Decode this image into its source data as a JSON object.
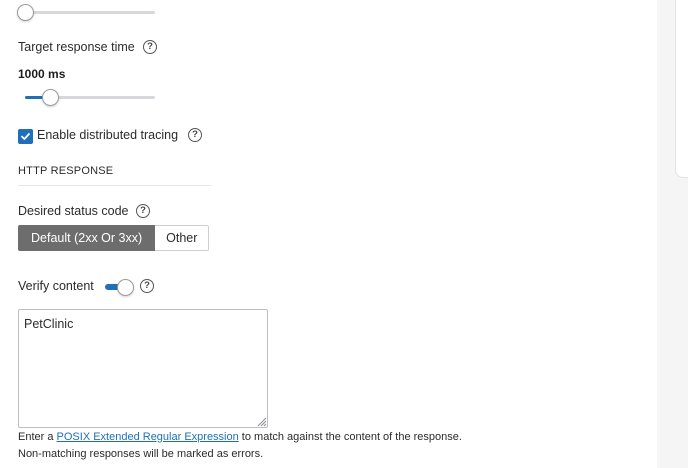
{
  "sliders": {
    "top": {
      "level": 0.0
    },
    "target_response": {
      "label": "Target response time",
      "value_text": "1000 ms",
      "level": 0.19
    }
  },
  "tracing": {
    "label": "Enable distributed tracing",
    "checked": true
  },
  "http_response": {
    "section_title": "HTTP RESPONSE",
    "status_code": {
      "label": "Desired status code",
      "options": [
        "Default (2xx Or 3xx)",
        "Other"
      ],
      "selected": "Default (2xx Or 3xx)"
    },
    "verify_content": {
      "label": "Verify content",
      "enabled": true,
      "value": "PetClinic"
    },
    "hint": {
      "prefix": "Enter a ",
      "link": "POSIX Extended Regular Expression",
      "suffix": " to match against the content of the response.",
      "line2": "Non-matching responses will be marked as errors."
    }
  },
  "help_glyph": "?",
  "icons": {
    "help": "help-circle-icon",
    "check": "check-icon",
    "resize": "resize-grip-icon"
  },
  "colors": {
    "accent": "#1f6fb9",
    "segment_active": "#6d6d6d",
    "track": "#d8d8dc"
  }
}
